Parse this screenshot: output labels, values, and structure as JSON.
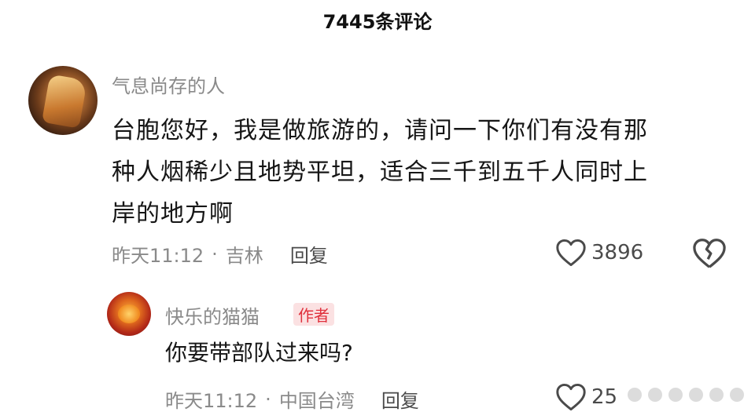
{
  "header": {
    "title": "7445条评论"
  },
  "comment": {
    "username": "气息尚存的人",
    "lines": [
      "台胞您好，我是做旅游的，请问一下你们有没有那",
      "种人烟稀少且地势平坦，适合三千到五千人同时上",
      "岸的地方啊"
    ],
    "time": "昨天11:12",
    "location": "吉林",
    "reply_label": "回复",
    "likes": "3896"
  },
  "reply": {
    "username": "快乐的猫猫",
    "author_badge": "作者",
    "text": "你要带部队过来吗?",
    "time": "昨天11:12",
    "location": "中国台湾",
    "reply_label": "回复",
    "likes_partial": "25"
  },
  "icons": {
    "like": "heart-outline-icon",
    "dislike": "broken-heart-icon"
  },
  "colors": {
    "badge_text": "#e0313d",
    "badge_bg": "#fbe1e2",
    "meta_gray": "#8a8a8a"
  }
}
